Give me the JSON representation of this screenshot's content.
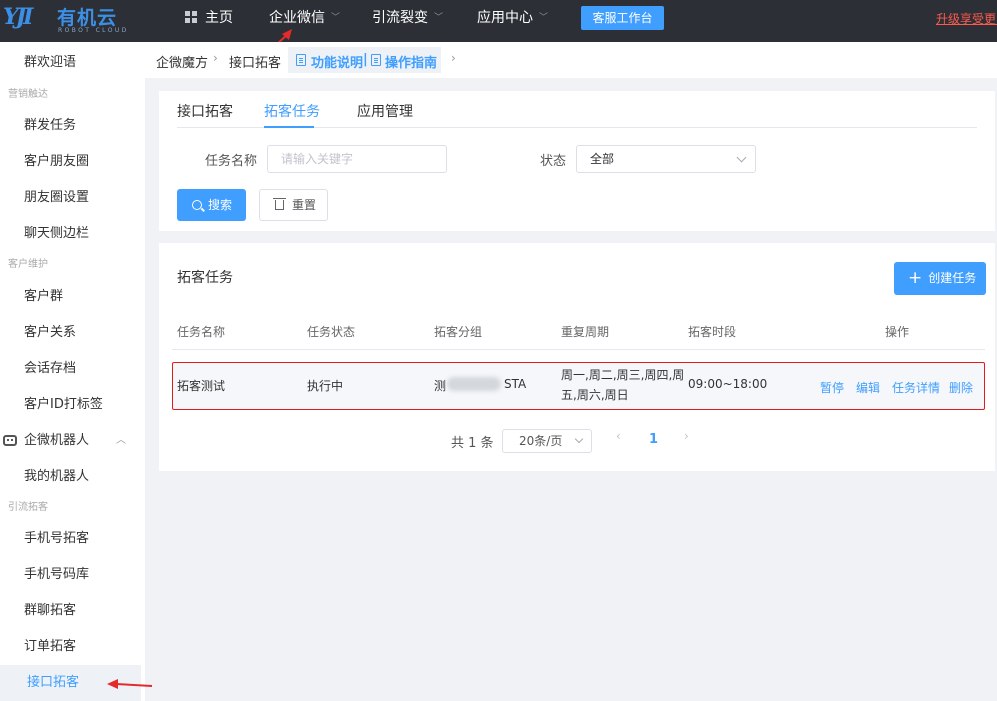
{
  "topbar": {
    "logo": {
      "mark": "YJI",
      "brand": "有机云",
      "sub": "ROBOT CLOUD"
    },
    "nav": [
      {
        "label": "主页",
        "icon": "grid-icon"
      },
      {
        "label": "企业微信"
      },
      {
        "label": "引流裂变"
      },
      {
        "label": "应用中心"
      }
    ],
    "service_button": "客服工作台",
    "upgrade_link": "升级享受更多"
  },
  "sidebar": {
    "items": [
      {
        "label": "群欢迎语"
      },
      {
        "group": "营销触达"
      },
      {
        "label": "群发任务"
      },
      {
        "label": "客户朋友圈"
      },
      {
        "label": "朋友圈设置"
      },
      {
        "label": "聊天侧边栏"
      },
      {
        "group": "客户维护"
      },
      {
        "label": "客户群"
      },
      {
        "label": "客户关系"
      },
      {
        "label": "会话存档"
      },
      {
        "label": "客户ID打标签"
      },
      {
        "label": "企微机器人",
        "icon": "robot-icon"
      },
      {
        "label": "我的机器人"
      },
      {
        "group": "引流拓客"
      },
      {
        "label": "手机号拓客"
      },
      {
        "label": "手机号码库"
      },
      {
        "label": "群聊拓客"
      },
      {
        "label": "订单拓客"
      },
      {
        "label": "接口拓客",
        "active": true
      }
    ]
  },
  "breadcrumb": {
    "items": [
      "企微魔方",
      "接口拓客"
    ],
    "guide_links": [
      "功能说明",
      "操作指南"
    ],
    "separator": "|"
  },
  "tabs": [
    "接口拓客",
    "拓客任务",
    "应用管理"
  ],
  "filter": {
    "task_name_label": "任务名称",
    "task_name_placeholder": "请输入关键字",
    "status_label": "状态",
    "status_value": "全部",
    "search_button": "搜索",
    "reset_button": "重置"
  },
  "table": {
    "title": "拓客任务",
    "create_button": "创建任务",
    "headers": [
      "任务名称",
      "任务状态",
      "拓客分组",
      "重复周期",
      "拓客时段",
      "操作"
    ],
    "rows": [
      {
        "name": "拓客测试",
        "status": "执行中",
        "group_prefix": "测",
        "group_suffix": "STA",
        "cycle_line1": "周一,周二,周三,周四,周",
        "cycle_line2": "五,周六,周日",
        "time": "09:00~18:00",
        "actions": [
          "暂停",
          "编辑",
          "任务详情",
          "删除"
        ]
      }
    ]
  },
  "pagination": {
    "total": "共 1 条",
    "page_size": "20条/页",
    "prev": "‹",
    "current": "1",
    "next": "›"
  },
  "colors": {
    "accent": "#409eff",
    "topbar": "#2c2f35",
    "highlight": "#e41b1b"
  }
}
